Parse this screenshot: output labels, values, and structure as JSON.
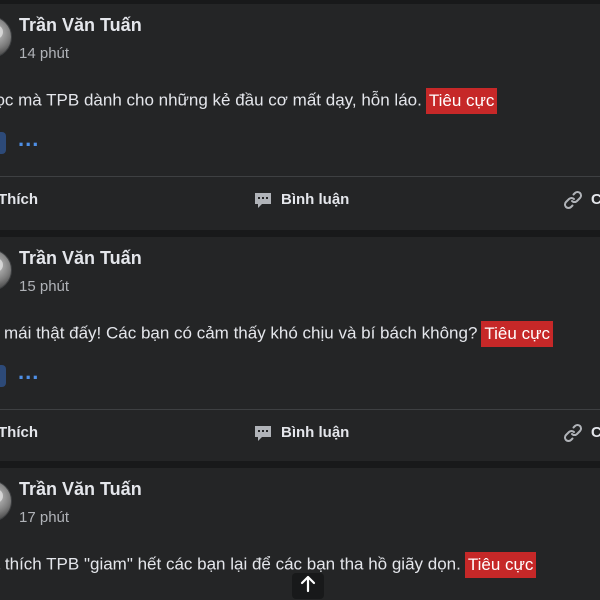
{
  "posts": [
    {
      "author": "Trần Văn Tuấn",
      "time": "14 phút",
      "text": "học mà TPB dành cho những kẻ đầu cơ mất dạy, hỗn láo.",
      "tag": "Tiêu cực"
    },
    {
      "author": "Trần Văn Tuấn",
      "time": "15 phút",
      "text": "ái mái thật đấy! Các bạn có cảm thấy khó chịu và bí bách không?",
      "tag": "Tiêu cực"
    },
    {
      "author": "Trần Văn Tuấn",
      "time": "17 phút",
      "text": "ất thích TPB \"giam\" hết các bạn lại để các bạn tha hồ giãy dọn.",
      "tag": "Tiêu cực"
    }
  ],
  "actions": {
    "like_label": "Thích",
    "comment_label": "Bình luận",
    "share_label": "C"
  },
  "more_label": "...",
  "icons": {
    "comment": "comment-bubble-icon",
    "share": "link-icon",
    "scroll_top": "arrow-up-icon"
  },
  "colors": {
    "background": "#18191a",
    "card": "#242526",
    "text": "#e4e6eb",
    "muted": "#b0b3b8",
    "tag_negative": "#c62828",
    "link": "#4e8fe6"
  }
}
